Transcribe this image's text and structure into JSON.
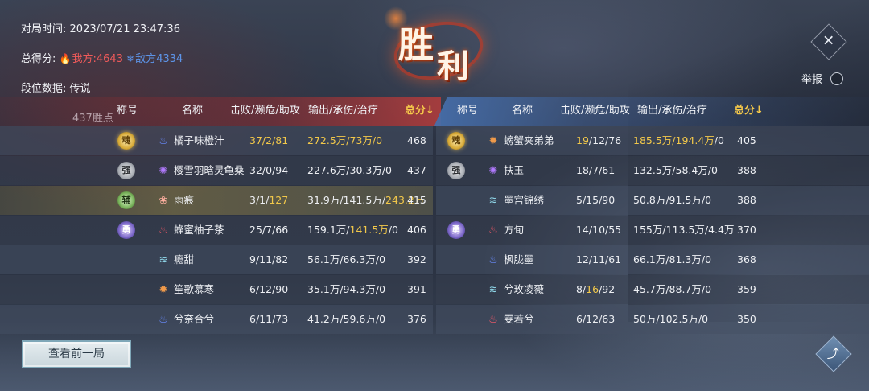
{
  "match_info": {
    "time_label": "对局时间:",
    "time_value": "2023/07/21 23:47:36",
    "score_label": "总得分:",
    "our_label": "我方",
    "our_score": "4643",
    "enemy_label": "敌方",
    "enemy_score": "4334",
    "rank_label": "段位数据:",
    "rank_value": "传说",
    "rank_points": "437胜点"
  },
  "victory": {
    "char1": "胜",
    "char2": "利"
  },
  "report_label": "举报",
  "headers": {
    "title": "称号",
    "name": "名称",
    "kda": "击败/濒危/助攻",
    "dmg": "输出/承伤/治疗",
    "score": "总分"
  },
  "headers_right": {
    "title": "称号",
    "name": "名称",
    "kda": "击败/濒危/助攻",
    "dmg": "输出/承伤/治疗",
    "score": "总分"
  },
  "left_team": [
    {
      "badge": "gold",
      "badge_char": "魂",
      "sect_icon": "blue-flame-icon",
      "name": "橘子味橙汁",
      "kda_hl": "37/2/81",
      "kda": "",
      "dmg_hl": "272.5万/73万/0",
      "dmg": "",
      "score": "468"
    },
    {
      "badge": "silver",
      "badge_char": "强",
      "sect_icon": "purple-swirl-icon",
      "name": "樱雪羽晗灵龟桑",
      "kda_hl": "",
      "kda": "32/0/94",
      "dmg_hl": "",
      "dmg": "227.6万/30.3万/0",
      "score": "437"
    },
    {
      "badge": "green",
      "badge_char": "辅",
      "sect_icon": "pink-lotus-icon",
      "name": "雨痕",
      "kda_pre": "3/1/",
      "kda_hl": "127",
      "kda": "",
      "dmg_pre": "31.9万/141.5万/",
      "dmg_hl": "243.2万",
      "dmg": "",
      "score": "415"
    },
    {
      "badge": "purple",
      "badge_char": "勇",
      "sect_icon": "red-flame-icon",
      "name": "蜂蜜柚子茶",
      "kda_hl": "",
      "kda": "25/7/66",
      "dmg_pre": "159.1万/",
      "dmg_hl": "141.5万",
      "dmg": "/0",
      "score": "406"
    },
    {
      "badge": "",
      "badge_char": "",
      "sect_icon": "teal-wave-icon",
      "name": "瘾甜",
      "kda_hl": "",
      "kda": "9/11/82",
      "dmg_hl": "",
      "dmg": "56.1万/66.3万/0",
      "score": "392"
    },
    {
      "badge": "",
      "badge_char": "",
      "sect_icon": "orange-gear-icon",
      "name": "笙歌慕寒",
      "kda_hl": "",
      "kda": "6/12/90",
      "dmg_hl": "",
      "dmg": "35.1万/94.3万/0",
      "score": "391"
    },
    {
      "badge": "",
      "badge_char": "",
      "sect_icon": "blue-flame-icon",
      "name": "兮奈合兮",
      "kda_hl": "",
      "kda": "6/11/73",
      "dmg_hl": "",
      "dmg": "41.2万/59.6万/0",
      "score": "376"
    }
  ],
  "right_team": [
    {
      "badge": "gold",
      "badge_char": "魂",
      "sect_icon": "orange-gear-icon",
      "name": "螃蟹夹弟弟",
      "kda_pre": "",
      "kda_hl": "19",
      "kda": "/12/76",
      "dmg_hl": "185.5万/194.4万",
      "dmg": "/0",
      "score": "405"
    },
    {
      "badge": "silver",
      "badge_char": "强",
      "sect_icon": "purple-swirl-icon",
      "name": "扶玉",
      "kda_hl": "",
      "kda": "18/7/61",
      "dmg_hl": "",
      "dmg": "132.5万/58.4万/0",
      "score": "388"
    },
    {
      "badge": "",
      "badge_char": "",
      "sect_icon": "teal-wave-icon",
      "name": "墨宫锦绣",
      "kda_hl": "",
      "kda": "5/15/90",
      "dmg_hl": "",
      "dmg": "50.8万/91.5万/0",
      "score": "388"
    },
    {
      "badge": "purple",
      "badge_char": "勇",
      "sect_icon": "red-flame-icon",
      "name": "方旬",
      "kda_hl": "",
      "kda": "14/10/55",
      "dmg_hl": "",
      "dmg": "155万/113.5万/4.4万",
      "score": "370"
    },
    {
      "badge": "",
      "badge_char": "",
      "sect_icon": "blue-flame-icon",
      "name": "枫胧墨",
      "kda_hl": "",
      "kda": "12/11/61",
      "dmg_hl": "",
      "dmg": "66.1万/81.3万/0",
      "score": "368"
    },
    {
      "badge": "",
      "badge_char": "",
      "sect_icon": "teal-wave-icon",
      "name": "兮玫凌薇",
      "kda_pre": "8/",
      "kda_hl": "16",
      "kda": "/92",
      "dmg_hl": "",
      "dmg": "45.7万/88.7万/0",
      "score": "359"
    },
    {
      "badge": "",
      "badge_char": "",
      "sect_icon": "red-flame-icon",
      "name": "雯若兮",
      "kda_hl": "",
      "kda": "6/12/63",
      "dmg_hl": "",
      "dmg": "50万/102.5万/0",
      "score": "350"
    }
  ],
  "prev_button_label": "查看前一局",
  "colors": {
    "ours": "#ef5a5a",
    "enemy": "#5d94e8",
    "highlight": "#f2c84a"
  }
}
